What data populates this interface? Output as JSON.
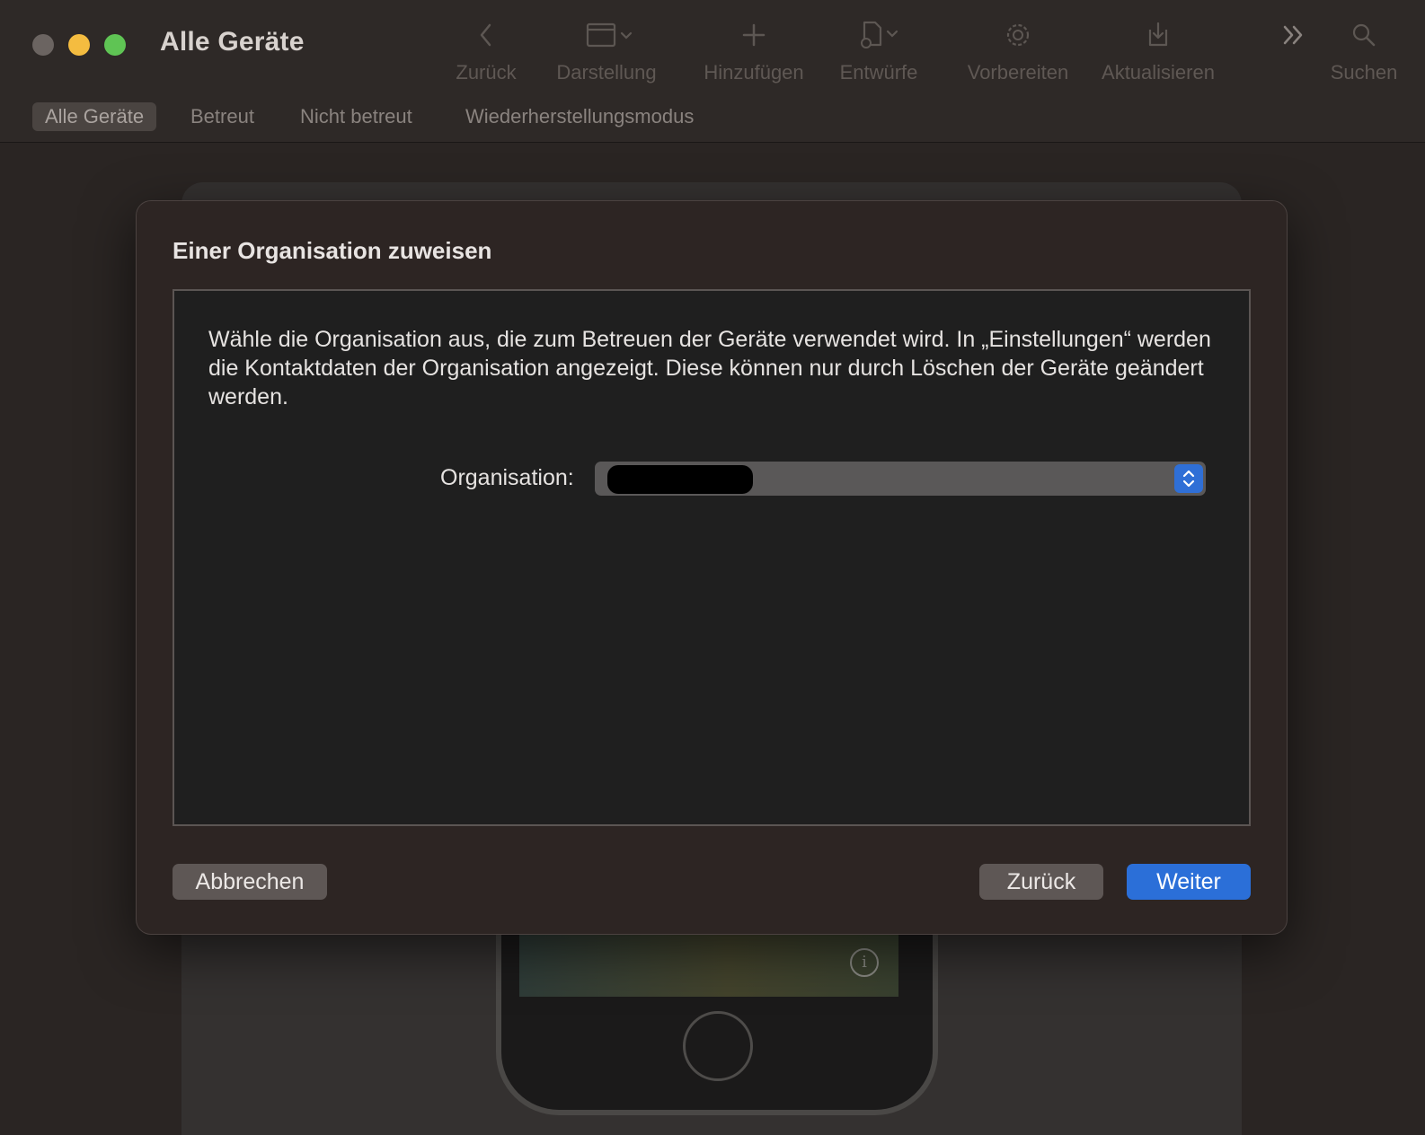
{
  "window": {
    "title": "Alle Geräte",
    "traffic_lights": {
      "close": "#6b6461",
      "minimize": "#f4bc40",
      "maximize": "#5fc454"
    }
  },
  "toolbar": {
    "items": [
      {
        "label": "Zurück",
        "icon": "chevron-left-icon"
      },
      {
        "label": "Darstellung",
        "icon": "window-layout-icon"
      },
      {
        "label": "Hinzufügen",
        "icon": "plus-icon"
      },
      {
        "label": "Entwürfe",
        "icon": "document-gear-icon"
      },
      {
        "label": "Vorbereiten",
        "icon": "gear-icon"
      },
      {
        "label": "Aktualisieren",
        "icon": "download-tray-icon"
      },
      {
        "label": "",
        "icon": "more-chevrons-icon"
      },
      {
        "label": "Suchen",
        "icon": "search-icon"
      }
    ]
  },
  "tabs": [
    {
      "label": "Alle Geräte",
      "active": true
    },
    {
      "label": "Betreut",
      "active": false
    },
    {
      "label": "Nicht betreut",
      "active": false
    },
    {
      "label": "Wiederherstellungsmodus",
      "active": false
    }
  ],
  "dialog": {
    "title": "Einer Organisation zuweisen",
    "description": "Wähle die Organisation aus, die zum Betreuen der Geräte verwendet wird. In „Einstellungen“ werden die Kontaktdaten der Organisation angezeigt. Diese können nur durch Löschen der Geräte geändert werden.",
    "organization_label": "Organisation:",
    "buttons": {
      "cancel": "Abbrechen",
      "back": "Zurück",
      "next": "Weiter"
    }
  },
  "colors": {
    "accent": "#2b6fd8",
    "background": "#2a2523"
  }
}
